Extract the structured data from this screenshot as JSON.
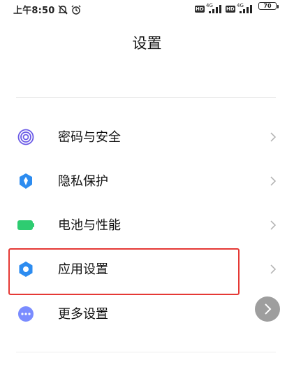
{
  "status_bar": {
    "time": "上午8:50",
    "hd_label": "HD",
    "network": "4G",
    "battery": "70",
    "icons": [
      "mute-icon",
      "alarm-icon",
      "signal-icon",
      "battery-icon"
    ]
  },
  "header": {
    "title": "设置"
  },
  "menu": {
    "items": [
      {
        "label": "密码与安全",
        "icon": "fingerprint-icon",
        "color": "#6c5ce7"
      },
      {
        "label": "隐私保护",
        "icon": "privacy-shield-icon",
        "color": "#2d8cf0"
      },
      {
        "label": "电池与性能",
        "icon": "battery-icon",
        "color": "#2ecc71"
      },
      {
        "label": "应用设置",
        "icon": "gear-icon",
        "color": "#2d8cf0"
      },
      {
        "label": "更多设置",
        "icon": "more-dots-icon",
        "color": "#7a8cff"
      }
    ]
  },
  "colors": {
    "highlight": "#e53935",
    "float_button": "#9e9e9e"
  }
}
